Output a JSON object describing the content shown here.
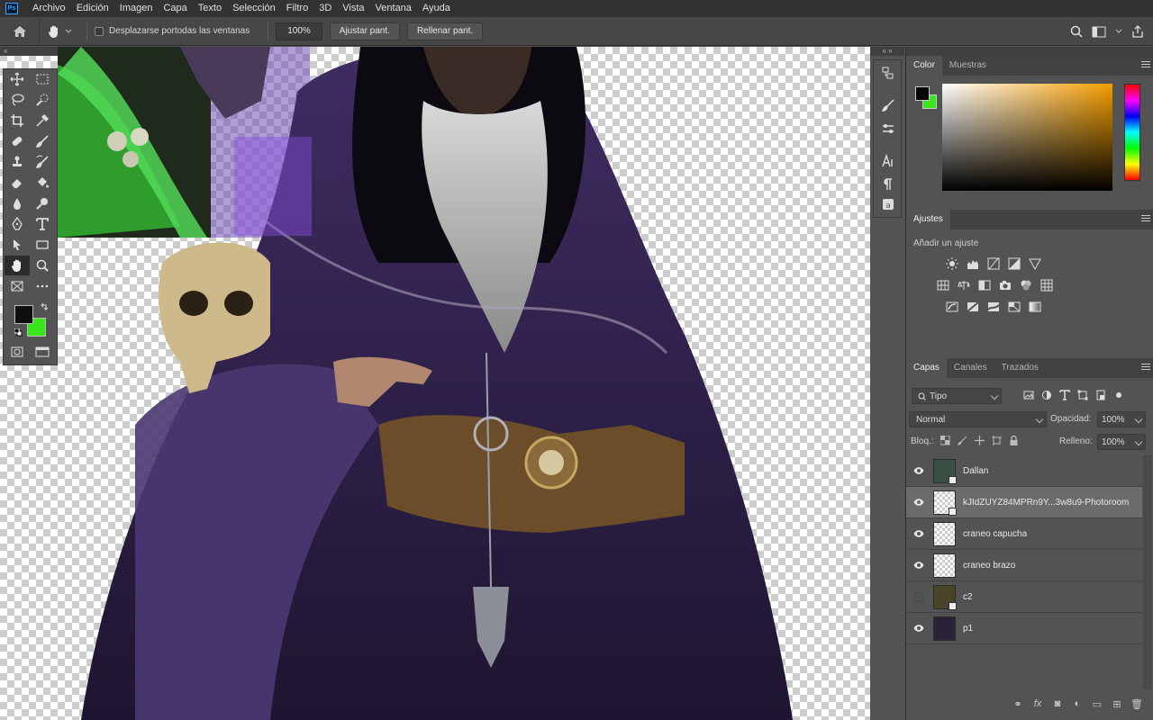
{
  "app": {
    "logo": "Ps"
  },
  "menu": [
    "Archivo",
    "Edición",
    "Imagen",
    "Capa",
    "Texto",
    "Selección",
    "Filtro",
    "3D",
    "Vista",
    "Ventana",
    "Ayuda"
  ],
  "options_bar": {
    "scroll_all_label": "Desplazarse portodas las ventanas",
    "zoom_value": "100%",
    "fit_screen_label": "Ajustar pant.",
    "fill_screen_label": "Rellenar pant."
  },
  "tools": [
    "move-icon",
    "marquee-icon",
    "lasso-icon",
    "quick-select-icon",
    "crop-icon",
    "eyedropper-icon",
    "healing-icon",
    "brush-icon",
    "stamp-icon",
    "history-brush-icon",
    "eraser-icon",
    "paint-bucket-icon",
    "blur-icon",
    "dodge-icon",
    "pen-icon",
    "type-icon",
    "path-select-icon",
    "rectangle-icon",
    "hand-icon",
    "zoom-icon",
    "frame-icon",
    "more-icon"
  ],
  "colors": {
    "foreground": "#0e0e0e",
    "background": "#39e61c",
    "accent": "#31a8ff"
  },
  "color_panel": {
    "tab_color": "Color",
    "tab_swatches": "Muestras"
  },
  "adjustments_panel": {
    "tab": "Ajustes",
    "subtitle": "Añadir un ajuste"
  },
  "layers_panel": {
    "tab_layers": "Capas",
    "tab_channels": "Canales",
    "tab_paths": "Trazados",
    "filter_label": "Tipo",
    "blend_mode": "Normal",
    "opacity_label": "Opacidad:",
    "opacity_value": "100%",
    "lock_label": "Bloq.:",
    "fill_label": "Relleno:",
    "fill_value": "100%",
    "layers": [
      {
        "name": "Dallan",
        "visible": true,
        "selected": false,
        "smart_object": true
      },
      {
        "name": "kJIdZUYZ84MPRn9Y...3w8u9-Photoroom",
        "visible": true,
        "selected": true,
        "smart_object": true
      },
      {
        "name": "craneo capucha",
        "visible": true,
        "selected": false,
        "smart_object": false
      },
      {
        "name": "craneo brazo",
        "visible": true,
        "selected": false,
        "smart_object": false
      },
      {
        "name": "c2",
        "visible": false,
        "selected": false,
        "smart_object": true
      },
      {
        "name": "p1",
        "visible": true,
        "selected": false,
        "smart_object": false
      }
    ],
    "footer_icons": [
      "link-icon",
      "fx-icon",
      "mask-icon",
      "adjustment-layer-icon",
      "group-icon",
      "new-layer-icon",
      "trash-icon"
    ]
  }
}
